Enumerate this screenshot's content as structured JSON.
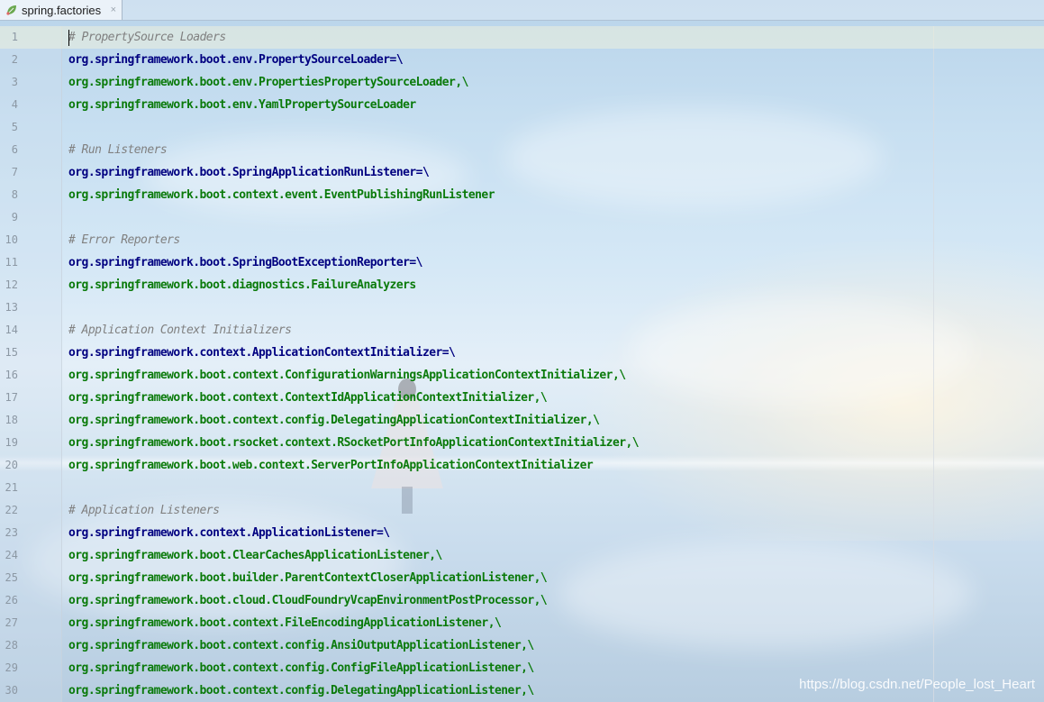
{
  "tab": {
    "title": "spring.factories",
    "close_glyph": "×",
    "icon": "spring-leaf-icon"
  },
  "editor": {
    "current_line": 1,
    "lines": [
      {
        "n": "1",
        "kind": "comment",
        "text": "# PropertySource Loaders"
      },
      {
        "n": "2",
        "kind": "key",
        "text": "org.springframework.boot.env.PropertySourceLoader=\\"
      },
      {
        "n": "3",
        "kind": "val",
        "text": "org.springframework.boot.env.PropertiesPropertySourceLoader,\\"
      },
      {
        "n": "4",
        "kind": "val",
        "text": "org.springframework.boot.env.YamlPropertySourceLoader"
      },
      {
        "n": "5",
        "kind": "blank",
        "text": ""
      },
      {
        "n": "6",
        "kind": "comment",
        "text": "# Run Listeners"
      },
      {
        "n": "7",
        "kind": "key",
        "text": "org.springframework.boot.SpringApplicationRunListener=\\"
      },
      {
        "n": "8",
        "kind": "val",
        "text": "org.springframework.boot.context.event.EventPublishingRunListener"
      },
      {
        "n": "9",
        "kind": "blank",
        "text": ""
      },
      {
        "n": "10",
        "kind": "comment",
        "text": "# Error Reporters"
      },
      {
        "n": "11",
        "kind": "key",
        "text": "org.springframework.boot.SpringBootExceptionReporter=\\"
      },
      {
        "n": "12",
        "kind": "val",
        "text": "org.springframework.boot.diagnostics.FailureAnalyzers"
      },
      {
        "n": "13",
        "kind": "blank",
        "text": ""
      },
      {
        "n": "14",
        "kind": "comment",
        "text": "# Application Context Initializers"
      },
      {
        "n": "15",
        "kind": "key",
        "text": "org.springframework.context.ApplicationContextInitializer=\\"
      },
      {
        "n": "16",
        "kind": "val",
        "text": "org.springframework.boot.context.ConfigurationWarningsApplicationContextInitializer,\\"
      },
      {
        "n": "17",
        "kind": "val",
        "text": "org.springframework.boot.context.ContextIdApplicationContextInitializer,\\"
      },
      {
        "n": "18",
        "kind": "val",
        "text": "org.springframework.boot.context.config.DelegatingApplicationContextInitializer,\\"
      },
      {
        "n": "19",
        "kind": "val",
        "text": "org.springframework.boot.rsocket.context.RSocketPortInfoApplicationContextInitializer,\\"
      },
      {
        "n": "20",
        "kind": "val",
        "text": "org.springframework.boot.web.context.ServerPortInfoApplicationContextInitializer"
      },
      {
        "n": "21",
        "kind": "blank",
        "text": ""
      },
      {
        "n": "22",
        "kind": "comment",
        "text": "# Application Listeners"
      },
      {
        "n": "23",
        "kind": "key",
        "text": "org.springframework.context.ApplicationListener=\\"
      },
      {
        "n": "24",
        "kind": "val",
        "text": "org.springframework.boot.ClearCachesApplicationListener,\\"
      },
      {
        "n": "25",
        "kind": "val",
        "text": "org.springframework.boot.builder.ParentContextCloserApplicationListener,\\"
      },
      {
        "n": "26",
        "kind": "val",
        "text": "org.springframework.boot.cloud.CloudFoundryVcapEnvironmentPostProcessor,\\"
      },
      {
        "n": "27",
        "kind": "val",
        "text": "org.springframework.boot.context.FileEncodingApplicationListener,\\"
      },
      {
        "n": "28",
        "kind": "val",
        "text": "org.springframework.boot.context.config.AnsiOutputApplicationListener,\\"
      },
      {
        "n": "29",
        "kind": "val",
        "text": "org.springframework.boot.context.config.ConfigFileApplicationListener,\\"
      },
      {
        "n": "30",
        "kind": "val",
        "text": "org.springframework.boot.context.config.DelegatingApplicationListener,\\"
      }
    ]
  },
  "watermark": "https://blog.csdn.net/People_lost_Heart",
  "colors": {
    "comment": "#808080",
    "key": "#000080",
    "value": "#0a7a0a",
    "line_number": "#8c98a4"
  }
}
